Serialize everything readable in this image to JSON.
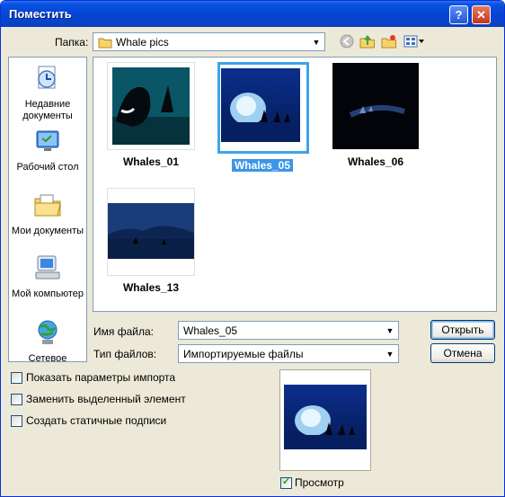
{
  "window": {
    "title": "Поместить",
    "help": "?",
    "close": "✕"
  },
  "lookin": {
    "label": "Папка:",
    "value": "Whale pics"
  },
  "places": [
    {
      "label": "Недавние документы",
      "icon": "recent-documents-icon"
    },
    {
      "label": "Рабочий стол",
      "icon": "desktop-icon"
    },
    {
      "label": "Мои документы",
      "icon": "my-documents-icon"
    },
    {
      "label": "Мой компьютер",
      "icon": "my-computer-icon"
    },
    {
      "label": "Сетевое",
      "icon": "network-icon"
    }
  ],
  "files": [
    {
      "name": "Whales_01",
      "selected": false
    },
    {
      "name": "Whales_05",
      "selected": true
    },
    {
      "name": "Whales_06",
      "selected": false
    },
    {
      "name": "Whales_13",
      "selected": false
    }
  ],
  "filename": {
    "label": "Имя файла:",
    "value": "Whales_05"
  },
  "filetype": {
    "label": "Тип файлов:",
    "value": "Импортируемые файлы"
  },
  "buttons": {
    "open": "Открыть",
    "cancel": "Отмена"
  },
  "options": [
    {
      "label": "Показать параметры импорта",
      "checked": false
    },
    {
      "label": "Заменить выделенный элемент",
      "checked": false
    },
    {
      "label": "Создать статичные подписи",
      "checked": false
    }
  ],
  "preview": {
    "label": "Просмотр",
    "checked": true
  },
  "colors": {
    "title_bar": "#0a53e0",
    "selection": "#3d95e8",
    "face": "#ece9d8"
  }
}
